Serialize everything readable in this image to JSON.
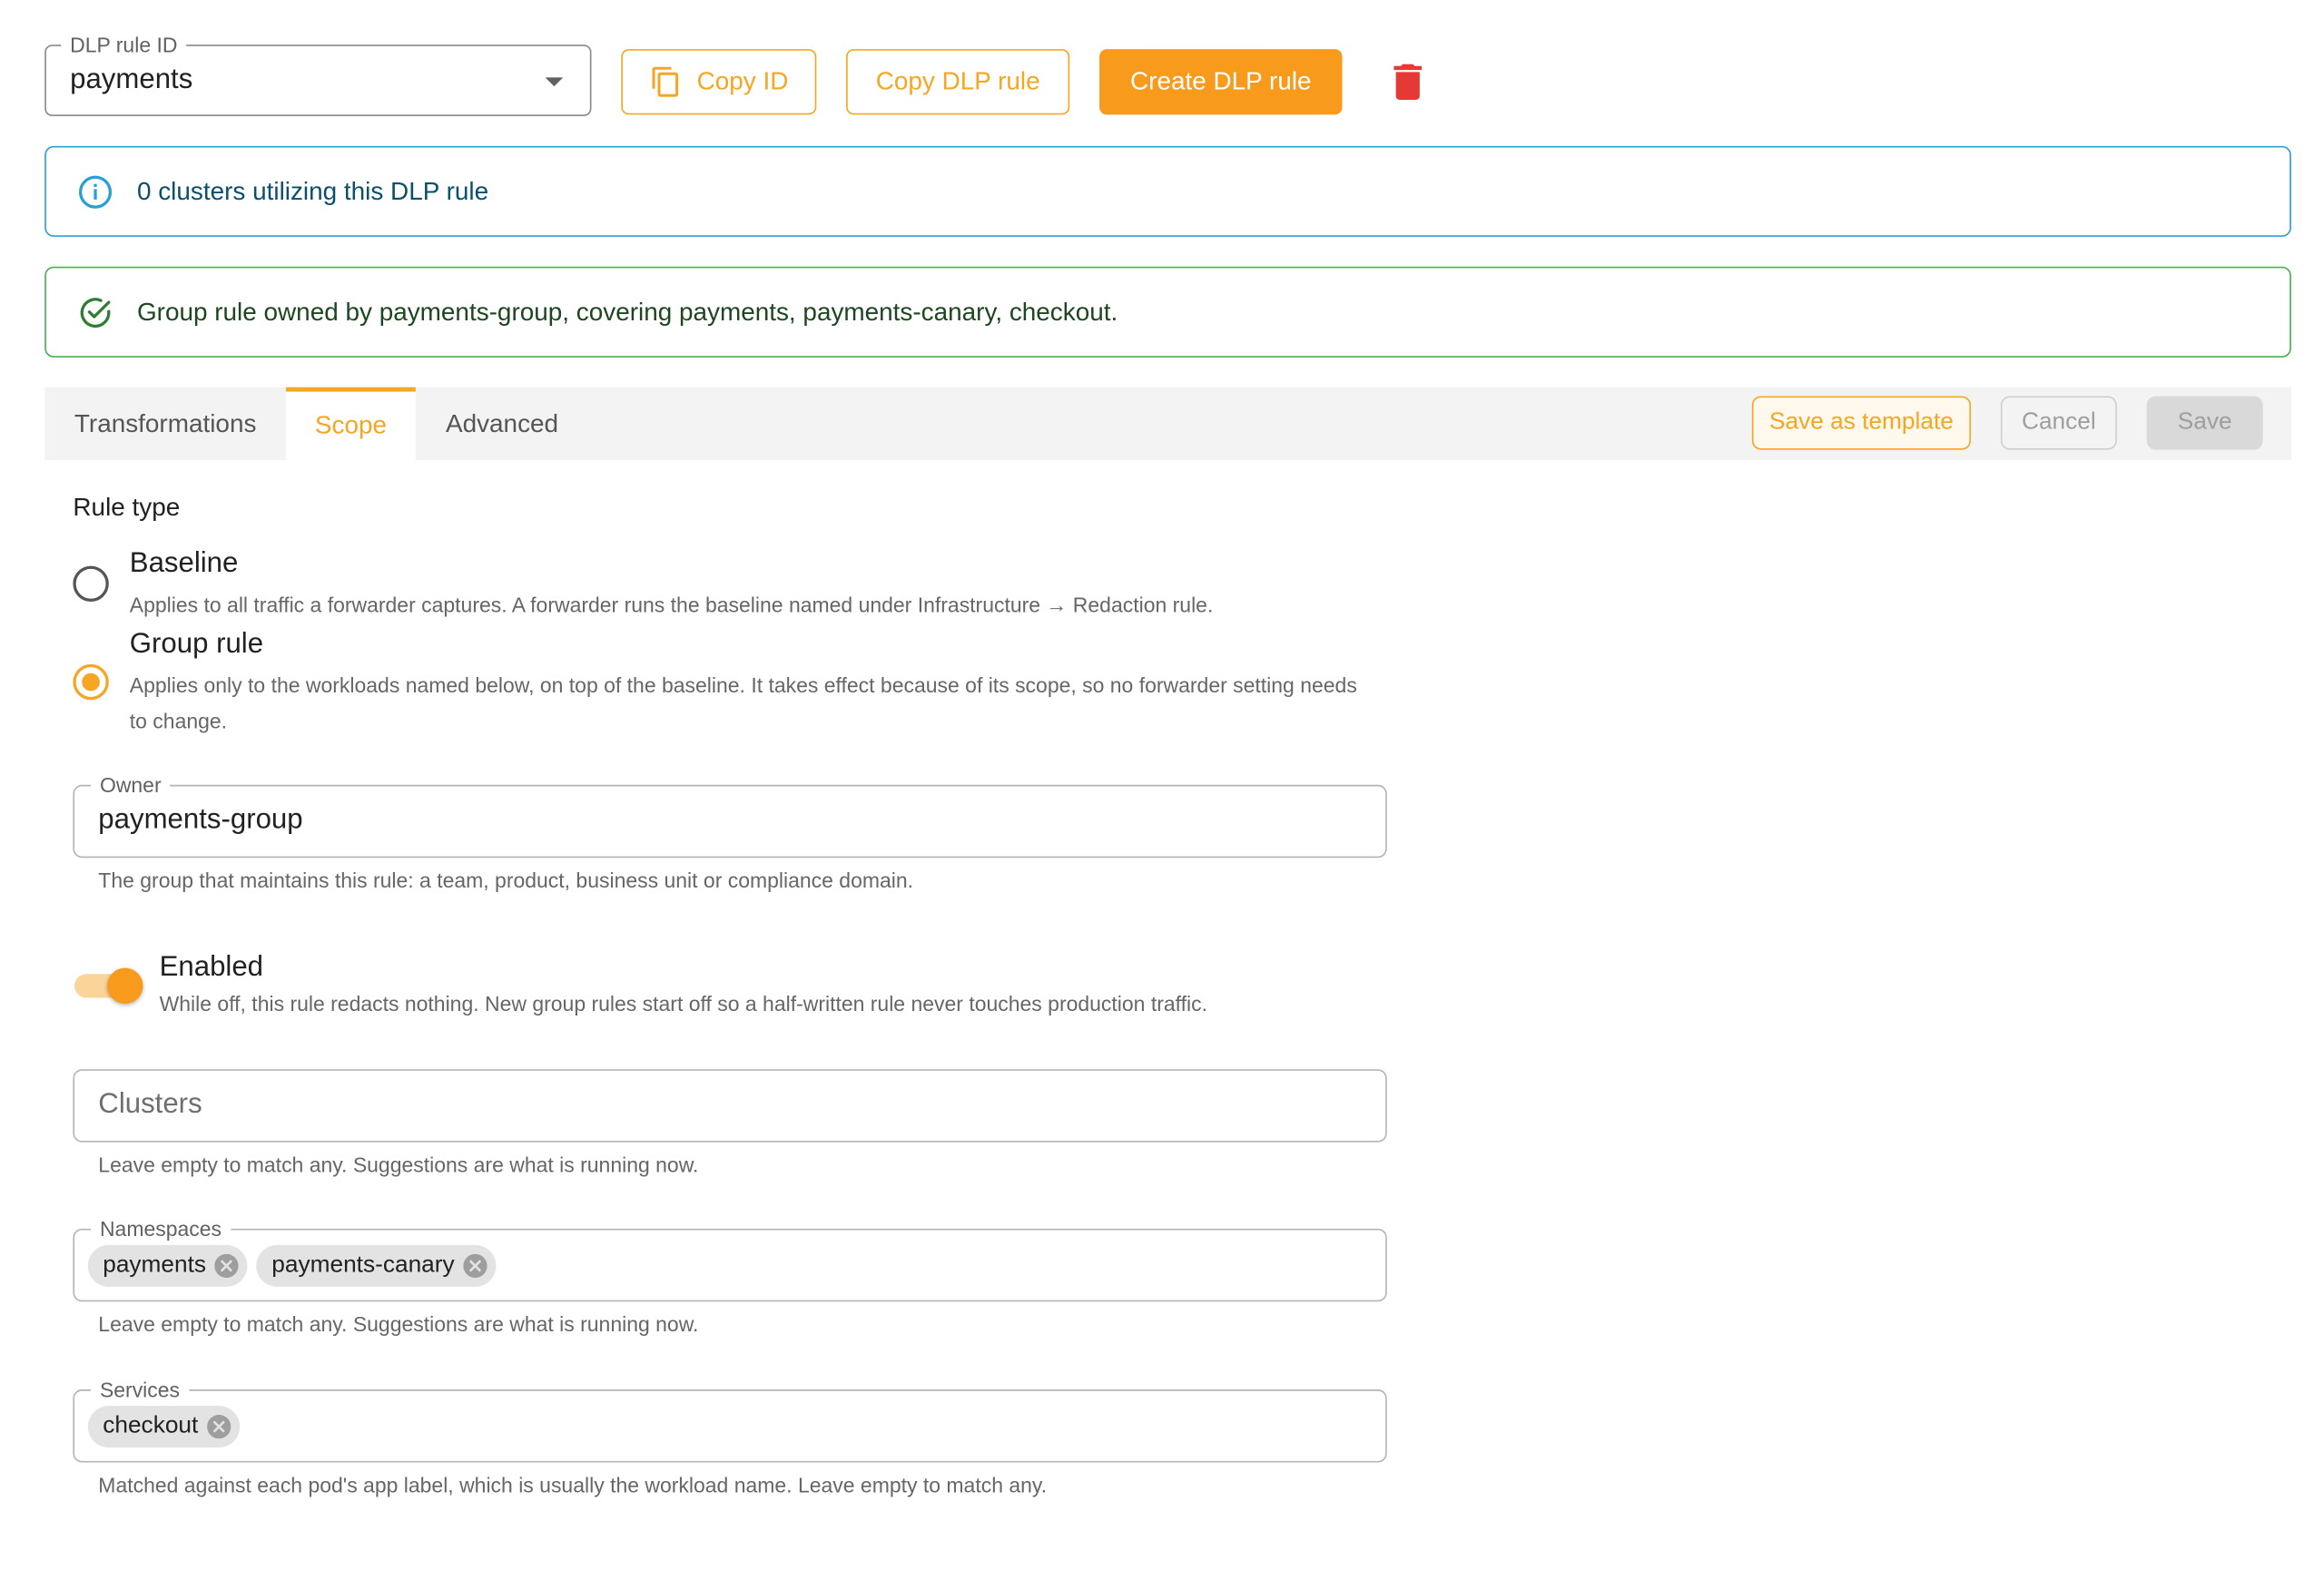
{
  "header": {
    "rule_id_label": "DLP rule ID",
    "rule_id_value": "payments",
    "copy_id_label": "Copy ID",
    "copy_rule_label": "Copy DLP rule",
    "create_rule_label": "Create DLP rule"
  },
  "alerts": {
    "info": "0 clusters utilizing this DLP rule",
    "success": "Group rule owned by payments-group, covering payments, payments-canary, checkout."
  },
  "tabs": [
    {
      "label": "Transformations"
    },
    {
      "label": "Scope"
    },
    {
      "label": "Advanced"
    }
  ],
  "tab_actions": {
    "save_template": "Save as template",
    "cancel": "Cancel",
    "save": "Save"
  },
  "rule_type": {
    "label": "Rule type",
    "options": [
      {
        "title": "Baseline",
        "desc": "Applies to all traffic a forwarder captures. A forwarder runs the baseline named under Infrastructure → Redaction rule.",
        "selected": false
      },
      {
        "title": "Group rule",
        "desc": "Applies only to the workloads named below, on top of the baseline. It takes effect because of its scope, so no forwarder setting needs to change.",
        "selected": true
      }
    ]
  },
  "owner": {
    "label": "Owner",
    "value": "payments-group",
    "helper": "The group that maintains this rule: a team, product, business unit or compliance domain."
  },
  "enabled": {
    "label": "Enabled",
    "desc": "While off, this rule redacts nothing. New group rules start off so a half-written rule never touches production traffic.",
    "on": true
  },
  "clusters": {
    "placeholder": "Clusters",
    "helper": "Leave empty to match any. Suggestions are what is running now."
  },
  "namespaces": {
    "label": "Namespaces",
    "chips": [
      "payments",
      "payments-canary"
    ],
    "helper": "Leave empty to match any. Suggestions are what is running now."
  },
  "services": {
    "label": "Services",
    "chips": [
      "checkout"
    ],
    "helper": "Matched against each pod's app label, which is usually the workload name. Leave empty to match any."
  },
  "colors": {
    "accent": "#f5a623",
    "info": "#2a9fd6",
    "success": "#4caf50",
    "danger": "#e53935"
  }
}
